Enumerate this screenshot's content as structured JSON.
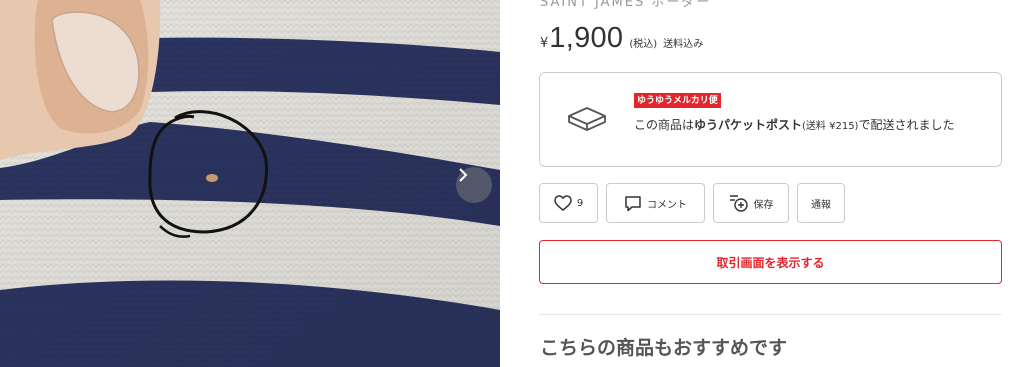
{
  "item": {
    "title_partial": "SAINT JAMES ボーダー",
    "currency_symbol": "¥",
    "price": "1,900",
    "tax_note": "(税込)",
    "shipping_note": "送料込み"
  },
  "shipping": {
    "badge": "ゆうゆうメルカリ便",
    "text_lead": "この商品は",
    "method": "ゆうパケットポスト",
    "fee": "(送料 ¥215)",
    "text_tail": "で配送されました",
    "icon": "parcel-box-icon"
  },
  "actions": {
    "like_icon": "heart-icon",
    "like_count": "9",
    "comment_icon": "comment-icon",
    "comment_label": "コメント",
    "save_icon": "save-list-icon",
    "save_label": "保存",
    "report_label": "通報"
  },
  "trade_button": "取引画面を表示する",
  "recommend_title": "こちらの商品もおすすめです",
  "photo": {
    "next_icon": "chevron-right-icon",
    "stripe_color": "#2e3766",
    "base_color": "#f1efe9"
  },
  "colors": {
    "accent": "#e3262e",
    "border": "#cccccc",
    "text": "#333333"
  }
}
